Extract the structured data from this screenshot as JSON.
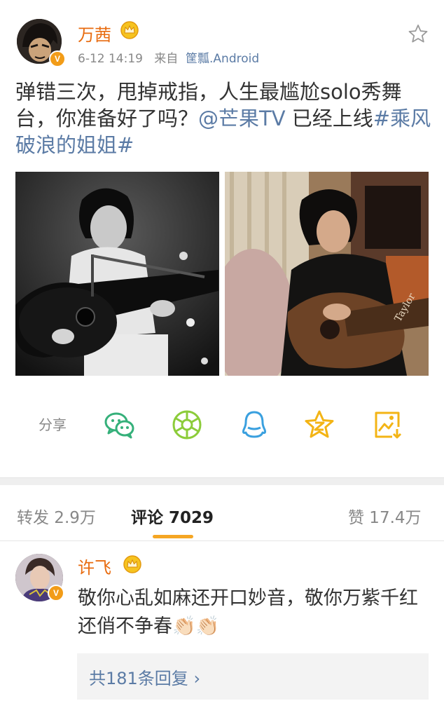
{
  "post": {
    "username": "万茜",
    "meta_time": "6-12 14:19",
    "meta_from": "来自",
    "meta_source": "筐瓢.Android",
    "text_before": "弹错三次，甩掉戒指，人生最尴尬solo秀舞台，你准备好了吗？",
    "mention": "@芒果TV",
    "text_mid": " 已经上线",
    "hashtag": "#乘风破浪的姐姐#",
    "verified_badge": "V",
    "crown_icon": "crown-icon"
  },
  "share": {
    "label": "分享",
    "icons": [
      "wechat-icon",
      "moments-icon",
      "qq-icon",
      "qzone-icon",
      "save-image-icon"
    ]
  },
  "tabs": {
    "repost": "转发 2.9万",
    "comment": "评论 7029",
    "like": "赞 17.4万",
    "active": "comment"
  },
  "comment": {
    "username": "许飞",
    "verified_badge": "V",
    "text": "敬你心乱如麻还开口妙音，敬你万紫千红还俏不争春👏🏻👏🏻",
    "replies": "共181条回复"
  },
  "colors": {
    "accent": "#e86b0f",
    "link": "#5b7ba5",
    "share_green": "#35b07a",
    "share_blue": "#3aa0df",
    "share_yellow": "#f3b415",
    "tab_underline": "#f5a623"
  }
}
